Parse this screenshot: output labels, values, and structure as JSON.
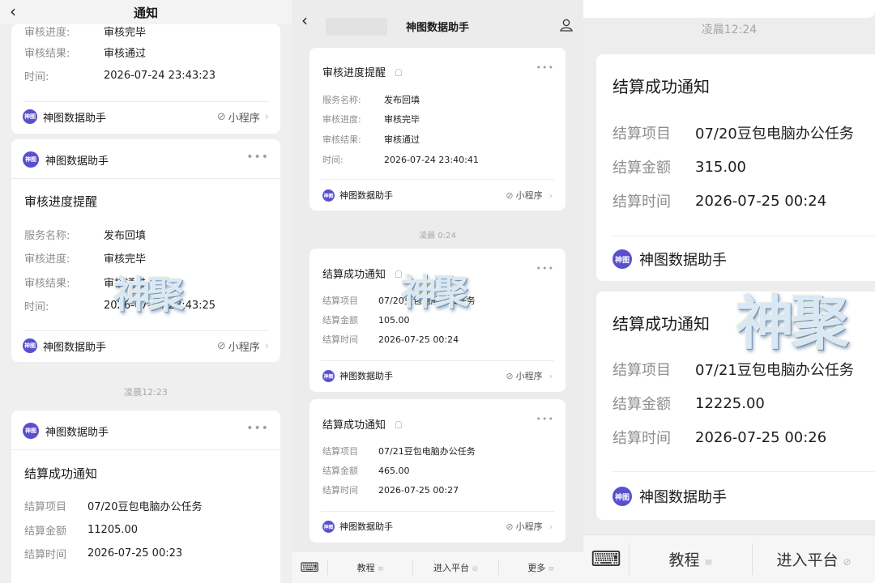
{
  "left": {
    "header_title": "通知",
    "card_top": {
      "rows": [
        {
          "label": "审核进度:",
          "value": "审核完毕"
        },
        {
          "label": "审核结果:",
          "value": "审核通过"
        },
        {
          "label": "时间:",
          "value": "2026-07-24 23:43:23"
        }
      ],
      "sender": "神图数据助手",
      "mini_program": "小程序"
    },
    "card_review": {
      "sender": "神图数据助手",
      "title": "审核进度提醒",
      "rows": [
        {
          "label": "服务名称:",
          "value": "发布回填"
        },
        {
          "label": "审核进度:",
          "value": "审核完毕"
        },
        {
          "label": "审核结果:",
          "value": "审核通过"
        },
        {
          "label": "时间:",
          "value": "2026-07-24 23:43:25"
        }
      ],
      "footer_sender": "神图数据助手",
      "mini_program": "小程序"
    },
    "timestamp": "凌晨12:23",
    "card_settle": {
      "sender": "神图数据助手",
      "title": "结算成功通知",
      "rows": [
        {
          "label": "结算项目",
          "value": "07/20豆包电脑办公任务"
        },
        {
          "label": "结算金额",
          "value": "11205.00"
        },
        {
          "label": "结算时间",
          "value": "2026-07-25 00:23"
        }
      ]
    }
  },
  "middle": {
    "header_title": "神图数据助手",
    "card_review": {
      "title": "审核进度提醒",
      "rows": [
        {
          "label": "服务名称:",
          "value": "发布回填"
        },
        {
          "label": "审核进度:",
          "value": "审核完毕"
        },
        {
          "label": "审核结果:",
          "value": "审核通过"
        },
        {
          "label": "时间:",
          "value": "2026-07-24 23:40:41"
        }
      ],
      "sender": "神图数据助手",
      "mini_program": "小程序"
    },
    "timestamp": "凌晨 0:24",
    "card_settle1": {
      "title": "结算成功通知",
      "rows": [
        {
          "label": "结算项目",
          "value": "07/20豆包电脑办公任务"
        },
        {
          "label": "结算金额",
          "value": "105.00"
        },
        {
          "label": "结算时间",
          "value": "2026-07-25 00:24"
        }
      ],
      "sender": "神图数据助手",
      "mini_program": "小程序"
    },
    "card_settle2": {
      "title": "结算成功通知",
      "rows": [
        {
          "label": "结算项目",
          "value": "07/21豆包电脑办公任务"
        },
        {
          "label": "结算金额",
          "value": "465.00"
        },
        {
          "label": "结算时间",
          "value": "2026-07-25 00:27"
        }
      ],
      "sender": "神图数据助手",
      "mini_program": "小程序"
    },
    "bottom_menu": [
      "教程",
      "进入平台",
      "更多"
    ]
  },
  "right": {
    "timestamp": "凌晨12:24",
    "card_settle1": {
      "title": "结算成功通知",
      "rows": [
        {
          "label": "结算项目",
          "value": "07/20豆包电脑办公任务"
        },
        {
          "label": "结算金额",
          "value": "315.00"
        },
        {
          "label": "结算时间",
          "value": "2026-07-25 00:24"
        }
      ],
      "sender": "神图数据助手"
    },
    "card_settle2": {
      "title": "结算成功通知",
      "rows": [
        {
          "label": "结算项目",
          "value": "07/21豆包电脑办公任务"
        },
        {
          "label": "结算金额",
          "value": "12225.00"
        },
        {
          "label": "结算时间",
          "value": "2026-07-25 00:26"
        }
      ],
      "sender": "神图数据助手"
    },
    "bottom_menu": [
      "教程",
      "进入平台"
    ]
  },
  "logo_text": "神图",
  "watermark_text": "神聚",
  "colors": {
    "logo": "#5a4fcf",
    "label": "#8e8e8e",
    "timestamp": "#a7a7a7"
  }
}
